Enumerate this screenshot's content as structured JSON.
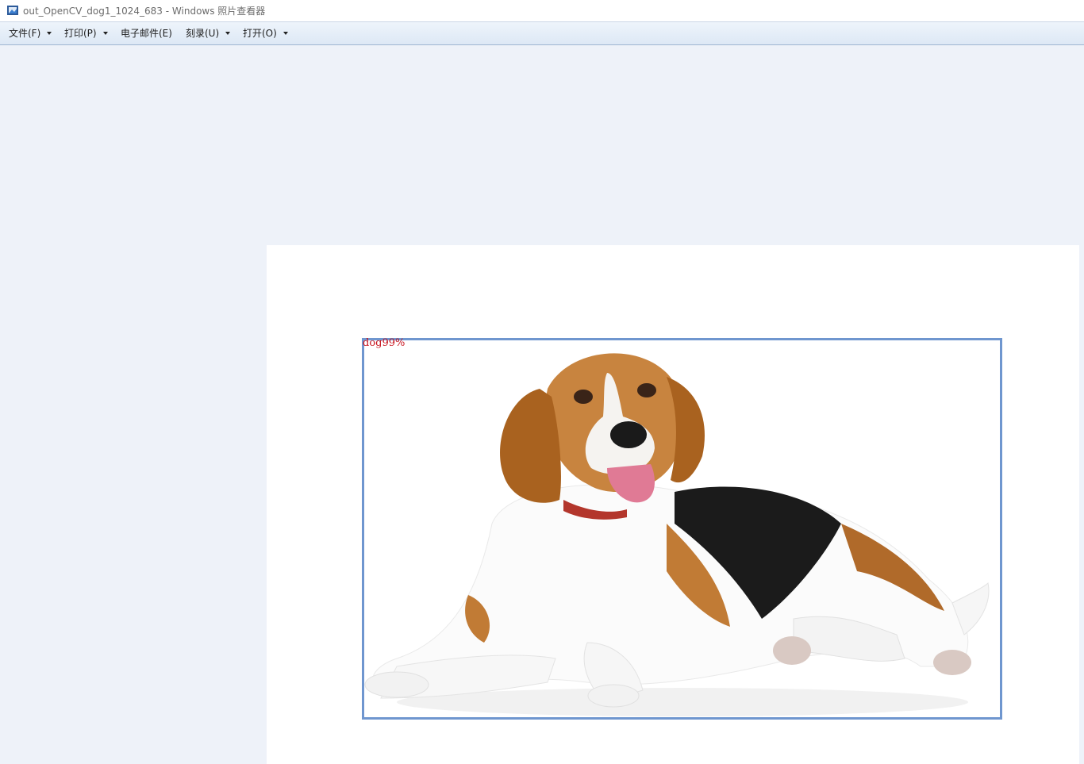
{
  "window": {
    "title": "out_OpenCV_dog1_1024_683 - Windows 照片查看器",
    "icon": "photo-viewer-icon"
  },
  "menu": [
    {
      "label": "文件(F)",
      "has_dropdown": true
    },
    {
      "label": "打印(P)",
      "has_dropdown": true
    },
    {
      "label": "电子邮件(E)",
      "has_dropdown": false
    },
    {
      "label": "刻录(U)",
      "has_dropdown": true
    },
    {
      "label": "打开(O)",
      "has_dropdown": true
    }
  ],
  "image": {
    "subject": "beagle-dog-photo",
    "detection": {
      "label": "dog99%",
      "box_color": "#6f96cf",
      "label_color": "#c8141e"
    }
  },
  "colors": {
    "viewer_background": "#eef2f9",
    "menubar": "#dde8f5"
  }
}
